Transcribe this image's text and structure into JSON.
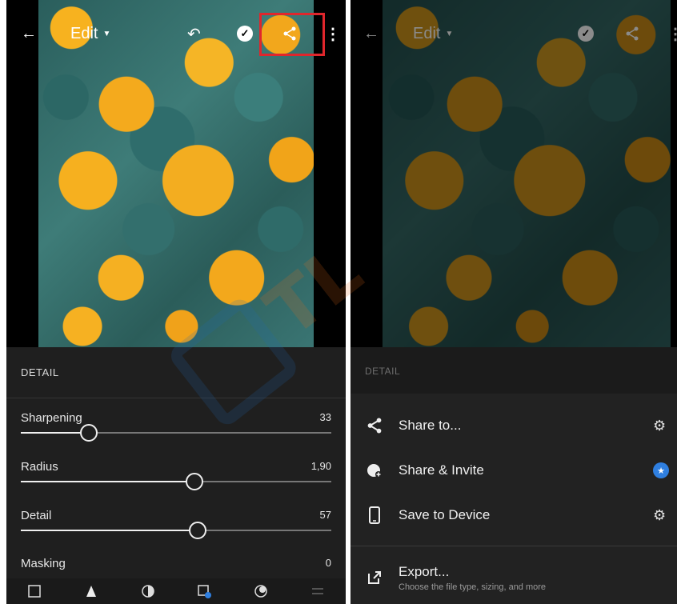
{
  "left": {
    "topbar": {
      "back_icon": "←",
      "title": "Edit",
      "undo_icon": "↶",
      "share_icon": "share",
      "more_icon": "⋮"
    },
    "detail_panel": {
      "header": "DETAIL",
      "sliders": [
        {
          "label": "Sharpening",
          "value": "33",
          "fraction": 0.22
        },
        {
          "label": "Radius",
          "value": "1,90",
          "fraction": 0.56
        },
        {
          "label": "Detail",
          "value": "57",
          "fraction": 0.57
        },
        {
          "label": "Masking",
          "value": "0",
          "fraction": 0.0
        }
      ]
    },
    "toolbar": [
      "crop-icon",
      "light-icon",
      "color-icon",
      "presets-icon",
      "effects-icon",
      "optics-icon"
    ]
  },
  "right": {
    "topbar": {
      "title": "Edit"
    },
    "detail_header": "DETAIL",
    "menu": [
      {
        "label": "Share to...",
        "icon": "share-icon",
        "right": "gear-icon"
      },
      {
        "label": "Share & Invite",
        "icon": "invite-icon",
        "right": "star-badge"
      },
      {
        "label": "Save to Device",
        "icon": "phone-icon",
        "right": "gear-icon"
      }
    ],
    "export": {
      "label": "Export...",
      "subtitle": "Choose the file type, sizing, and more"
    }
  },
  "colors": {
    "highlight": "#e0262c",
    "sheet_bg": "#1f1f1f",
    "accent_blue": "#2f7fe0"
  }
}
